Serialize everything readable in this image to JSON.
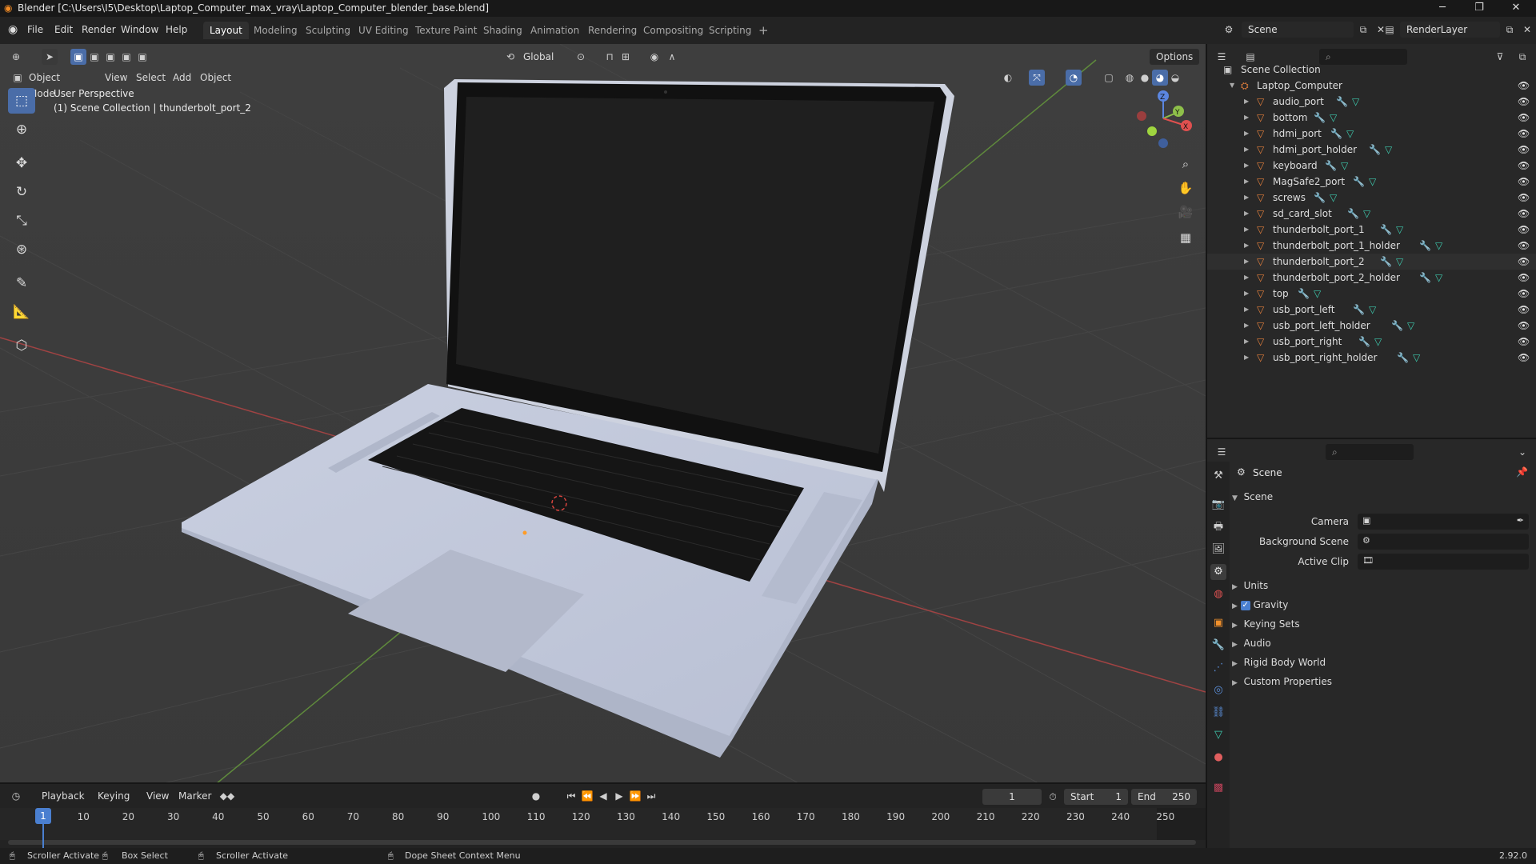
{
  "window": {
    "title": "Blender [C:\\Users\\I5\\Desktop\\Laptop_Computer_max_vray\\Laptop_Computer_blender_base.blend]",
    "minimize": "─",
    "restore": "❐",
    "close": "✕"
  },
  "menubar": {
    "items": [
      "File",
      "Edit",
      "Render",
      "Window",
      "Help"
    ],
    "workspaces": [
      "Layout",
      "Modeling",
      "Sculpting",
      "UV Editing",
      "Texture Paint",
      "Shading",
      "Animation",
      "Rendering",
      "Compositing",
      "Scripting"
    ],
    "add_tab": "+",
    "scene_name": "Scene",
    "view_layer": "RenderLayer"
  },
  "viewport": {
    "transform_orientation": "Global",
    "options_label": "Options",
    "mode": "Object Mode",
    "menus": [
      "View",
      "Select",
      "Add",
      "Object"
    ],
    "perspective_label": "User Perspective",
    "collection_label": "(1) Scene Collection | thunderbolt_port_2",
    "gizmo": {
      "x": "X",
      "y": "Y",
      "z": "Z"
    }
  },
  "outliner": {
    "root": "Scene Collection",
    "collection": "Laptop_Computer",
    "selected": "thunderbolt_port_2",
    "objects": [
      "audio_port",
      "bottom",
      "hdmi_port",
      "hdmi_port_holder",
      "keyboard",
      "MagSafe2_port",
      "screws",
      "sd_card_slot",
      "thunderbolt_port_1",
      "thunderbolt_port_1_holder",
      "thunderbolt_port_2",
      "thunderbolt_port_2_holder",
      "top",
      "usb_port_left",
      "usb_port_left_holder",
      "usb_port_right",
      "usb_port_right_holder"
    ]
  },
  "properties": {
    "header": "Scene",
    "panel": "Scene",
    "camera_label": "Camera",
    "background_scene_label": "Background Scene",
    "active_clip_label": "Active Clip",
    "subpanels": [
      "Units",
      "Gravity",
      "Keying Sets",
      "Audio",
      "Rigid Body World",
      "Custom Properties"
    ],
    "gravity_checked": true
  },
  "timeline": {
    "menus": [
      "Playback",
      "Keying",
      "View",
      "Marker"
    ],
    "current_frame": "1",
    "start_label": "Start",
    "start": "1",
    "end_label": "End",
    "end": "250",
    "ticks": [
      "10",
      "20",
      "30",
      "40",
      "50",
      "60",
      "70",
      "80",
      "90",
      "100",
      "110",
      "120",
      "130",
      "140",
      "150",
      "160",
      "170",
      "180",
      "190",
      "200",
      "210",
      "220",
      "230",
      "240",
      "250"
    ],
    "playhead": "1"
  },
  "statusbar": {
    "items": [
      "Scroller Activate",
      "Box Select",
      "Scroller Activate",
      "Dope Sheet Context Menu"
    ],
    "version": "2.92.0"
  }
}
